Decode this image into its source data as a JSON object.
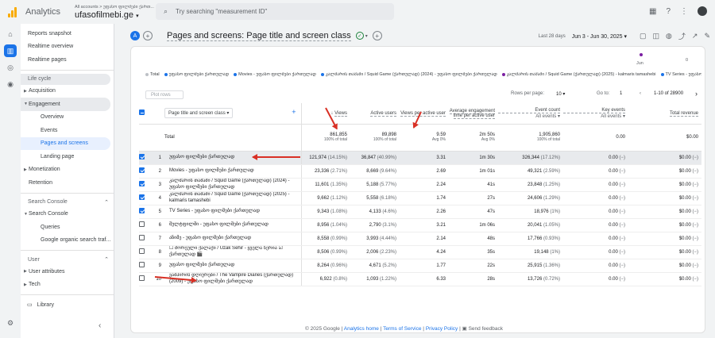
{
  "topbar": {
    "brand": "Analytics",
    "crumb": "All accounts > უფასო ფილმები ქართ...",
    "property": "ufasofilmebi.ge",
    "search_placeholder": "Try searching \"measurement ID\""
  },
  "sidebar": {
    "top_items": [
      "Reports snapshot",
      "Realtime overview",
      "Realtime pages"
    ],
    "section_lifecycle": "Life cycle",
    "acquisition": "Acquisition",
    "engagement": "Engagement",
    "engagement_items": [
      "Overview",
      "Events",
      "Pages and screens",
      "Landing page"
    ],
    "monetization": "Monetization",
    "retention": "Retention",
    "section_search": "Search Console",
    "search_console": "Search Console",
    "search_items": [
      "Queries",
      "Google organic search traf..."
    ],
    "section_user": "User",
    "user_attributes": "User attributes",
    "tech": "Tech",
    "library": "Library"
  },
  "header": {
    "avatar_letter": "A",
    "title": "Pages and screens: Page title and screen class",
    "date_label": "Last 28 days",
    "date_range": "Jun 3 - Jun 30, 2025"
  },
  "chart_strip": {
    "x_label": "Jun",
    "y_label": "0",
    "legend": [
      {
        "label": "Total",
        "color": "#bdc1c6"
      },
      {
        "label": "უფასო ფილმები ქართულად",
        "color": "#1a73e8"
      },
      {
        "label": "Movies - უფასო ფილმები ქართულად",
        "color": "#1a73e8"
      },
      {
        "label": "კალმარის თამაში / Squid Game (ქართულად) (2024) - უფასო ფილმები ქართულად",
        "color": "#1a73e8"
      },
      {
        "label": "კალმარის თამაში / Squid Game (ქართულად) (2025) - kalmaris tamashebi",
        "color": "#7b1fa2"
      },
      {
        "label": "TV Series - უფასო ...",
        "color": "#1a73e8"
      }
    ]
  },
  "controls": {
    "plot_rows": "Plot rows",
    "rows_per_page_label": "Rows per page:",
    "rows_per_page": "10",
    "goto_label": "Go to:",
    "goto_value": "1",
    "page_info": "1-10 of 28900"
  },
  "table": {
    "dimension": "Page title and screen class",
    "columns": {
      "views": "Views",
      "active_users": "Active users",
      "views_per_user": "Views per active user",
      "avg_engagement": "Average engagement time per active user",
      "event_count": "Event count",
      "key_events": "Key events",
      "total_revenue": "Total revenue",
      "all_events": "All events"
    },
    "total": {
      "label": "Total",
      "views": "861,855",
      "views_sub": "100% of total",
      "users": "89,898",
      "users_sub": "100% of total",
      "vpu": "9.59",
      "vpu_sub": "Avg 0%",
      "eng": "2m 50s",
      "eng_sub": "Avg 0%",
      "events": "1,905,860",
      "events_sub": "100% of total",
      "key": "0.00",
      "revenue": "$0.00"
    },
    "rows": [
      {
        "n": "1",
        "title": "უფასო ფილმები ქართულად",
        "views": "121,974",
        "vp": "(14.15%)",
        "users": "36,847",
        "up": "(40.99%)",
        "vpu": "3.31",
        "eng": "1m 30s",
        "events": "326,344",
        "ep": "(17.12%)",
        "key": "0.00",
        "kp": "(−)",
        "rev": "$0.00",
        "rp": "(−)",
        "checked": true
      },
      {
        "n": "2",
        "title": "Movies - უფასო ფილმები ქართულად",
        "views": "23,336",
        "vp": "(2.71%)",
        "users": "8,669",
        "up": "(9.64%)",
        "vpu": "2.69",
        "eng": "1m 01s",
        "events": "49,321",
        "ep": "(2.59%)",
        "key": "0.00",
        "kp": "(−)",
        "rev": "$0.00",
        "rp": "(−)",
        "checked": true
      },
      {
        "n": "3",
        "title": "კალმარის თამაში / Squid Game (ქართულად) (2024) - უფასო ფილმები ქართულად",
        "views": "11,601",
        "vp": "(1.35%)",
        "users": "5,188",
        "up": "(5.77%)",
        "vpu": "2.24",
        "eng": "41s",
        "events": "23,848",
        "ep": "(1.25%)",
        "key": "0.00",
        "kp": "(−)",
        "rev": "$0.00",
        "rp": "(−)",
        "checked": true
      },
      {
        "n": "4",
        "title": "კალმარის თამაში / Squid Game (ქართულად) (2025) - kalmaris tamashebi",
        "views": "9,662",
        "vp": "(1.12%)",
        "users": "5,558",
        "up": "(6.18%)",
        "vpu": "1.74",
        "eng": "27s",
        "events": "24,606",
        "ep": "(1.29%)",
        "key": "0.00",
        "kp": "(−)",
        "rev": "$0.00",
        "rp": "(−)",
        "checked": true
      },
      {
        "n": "5",
        "title": "TV Series - უფასო ფილმები ქართულად",
        "views": "9,343",
        "vp": "(1.08%)",
        "users": "4,133",
        "up": "(4.6%)",
        "vpu": "2.26",
        "eng": "47s",
        "events": "18,976",
        "ep": "(1%)",
        "key": "0.00",
        "kp": "(−)",
        "rev": "$0.00",
        "rp": "(−)",
        "checked": true
      },
      {
        "n": "6",
        "title": "მულტფილმი - უფასო ფილმები ქართულად",
        "views": "8,956",
        "vp": "(1.04%)",
        "users": "2,790",
        "up": "(3.1%)",
        "vpu": "3.21",
        "eng": "1m 06s",
        "events": "20,041",
        "ep": "(1.05%)",
        "key": "0.00",
        "kp": "(−)",
        "rev": "$0.00",
        "rp": "(−)",
        "checked": false
      },
      {
        "n": "7",
        "title": "ანიმე - უფასო ფილმები ქართულად",
        "views": "8,558",
        "vp": "(0.99%)",
        "users": "3,993",
        "up": "(4.44%)",
        "vpu": "2.14",
        "eng": "48s",
        "events": "17,766",
        "ep": "(0.93%)",
        "key": "0.00",
        "kp": "(−)",
        "rev": "$0.00",
        "rp": "(−)",
        "checked": false
      },
      {
        "n": "8",
        "title": "☐ შორეული ქალაქი / Uzak Sehir - ყველა სერია ☑ ქართულად 🎬",
        "views": "8,506",
        "vp": "(0.99%)",
        "users": "2,006",
        "up": "(2.23%)",
        "vpu": "4.24",
        "eng": "35s",
        "events": "19,148",
        "ep": "(1%)",
        "key": "0.00",
        "kp": "(−)",
        "rev": "$0.00",
        "rp": "(−)",
        "checked": false
      },
      {
        "n": "9",
        "title": "უფასო ფილმები ქართულად",
        "views": "8,264",
        "vp": "(0.96%)",
        "users": "4,671",
        "up": "(5.2%)",
        "vpu": "1.77",
        "eng": "22s",
        "events": "25,915",
        "ep": "(1.36%)",
        "key": "0.00",
        "kp": "(−)",
        "rev": "$0.00",
        "rp": "(−)",
        "checked": false
      },
      {
        "n": "10",
        "title": "ვამპირის დღიურები / The Vampire Diaries (ქართულად) (2009) - უფასო ფილმები ქართულად",
        "views": "6,922",
        "vp": "(0.8%)",
        "users": "1,093",
        "up": "(1.22%)",
        "vpu": "6.33",
        "eng": "28s",
        "events": "13,726",
        "ep": "(0.72%)",
        "key": "0.00",
        "kp": "(−)",
        "rev": "$0.00",
        "rp": "(−)",
        "checked": false
      }
    ]
  },
  "footer": {
    "copyright": "© 2025 Google |",
    "analytics_home": "Analytics home",
    "sep1": "|",
    "terms": "Terms of Service",
    "sep2": "|",
    "privacy": "Privacy Policy",
    "sep3": "|",
    "feedback": "Send feedback"
  },
  "colors": {
    "accent": "#1a73e8",
    "annotation_arrow": "#d93025",
    "logo": "#f9ab00"
  }
}
